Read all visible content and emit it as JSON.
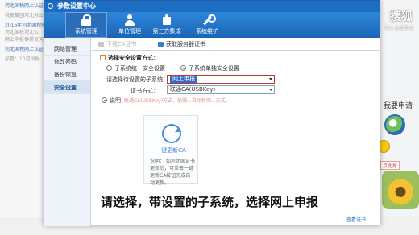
{
  "background": {
    "left_lines": [
      {
        "text": "河北国税网上认证",
        "style": "blue"
      },
      {
        "text": "税友集团河北分公",
        "style": "normal"
      },
      {
        "text": "2016年河北国税网",
        "style": "blue"
      },
      {
        "text": "河北国税河北公",
        "style": "normal"
      },
      {
        "text": "网上申报供常见问",
        "style": "normal"
      },
      {
        "text": "河北国税网上认证",
        "style": "blue"
      },
      {
        "text": "必看：10月份报",
        "style": "normal"
      }
    ],
    "brand": "搜狐",
    "brand_url": "tv.sohu",
    "want_text": "我要申请",
    "click_text": "点此抢"
  },
  "dialog": {
    "title": "参数设置中心",
    "toolbar": [
      {
        "label": "系统管理",
        "icon": "lock-icon",
        "active": true
      },
      {
        "label": "单位管理",
        "icon": "people-icon",
        "active": false
      },
      {
        "label": "第三方集成",
        "icon": "puzzle-icon",
        "active": false
      },
      {
        "label": "系统维护",
        "icon": "wrench-icon",
        "active": false
      }
    ],
    "sidebar": [
      {
        "label": "网络管理",
        "active": false
      },
      {
        "label": "修改密码",
        "active": false
      },
      {
        "label": "备份恢复",
        "active": false
      },
      {
        "label": "安全设置",
        "active": true
      }
    ],
    "tabs": {
      "prev_label": "下载CA证书",
      "cert_label": "获取服务器证书"
    },
    "section_title": "选择安全设置方式：",
    "radio_a": "子系统统一安全设置",
    "radio_b": "子系统单独安全设置",
    "subsystem_label": "请选择待设置的子系统：",
    "subsystem_value": "网上申报",
    "cert_label": "证书方式：",
    "cert_value": "联通CA(USBKey)",
    "desc_label": "说明：",
    "desc_text": "联通CA(USBKey)方式，仍需...自动检测...方式。",
    "update_title": "一键更新CA",
    "update_desc": "说明：  如河北国证书更新后，可单击一键更新CA按钮完成自动更新。",
    "view_cert": "查看证书"
  },
  "subtitle": "请选择，带设置的子系统，选择网上申报"
}
